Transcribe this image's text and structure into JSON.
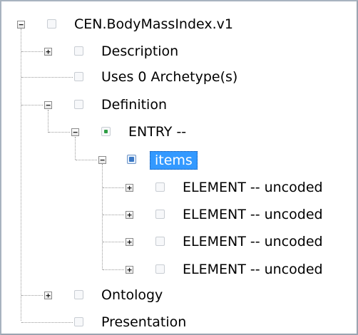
{
  "tree": {
    "root": "CEN.BodyMassIndex.v1",
    "description": "Description",
    "uses": "Uses 0 Archetype(s)",
    "definition": "Definition",
    "entry": "ENTRY --",
    "items": "items",
    "elements": [
      "ELEMENT -- uncoded",
      "ELEMENT -- uncoded",
      "ELEMENT -- uncoded",
      "ELEMENT -- uncoded"
    ],
    "ontology": "Ontology",
    "presentation": "Presentation"
  },
  "selected_item": "items",
  "colors": {
    "selection": "#3399ff",
    "entry_marker": "#2f9e44",
    "items_marker": "#3a78c5"
  }
}
